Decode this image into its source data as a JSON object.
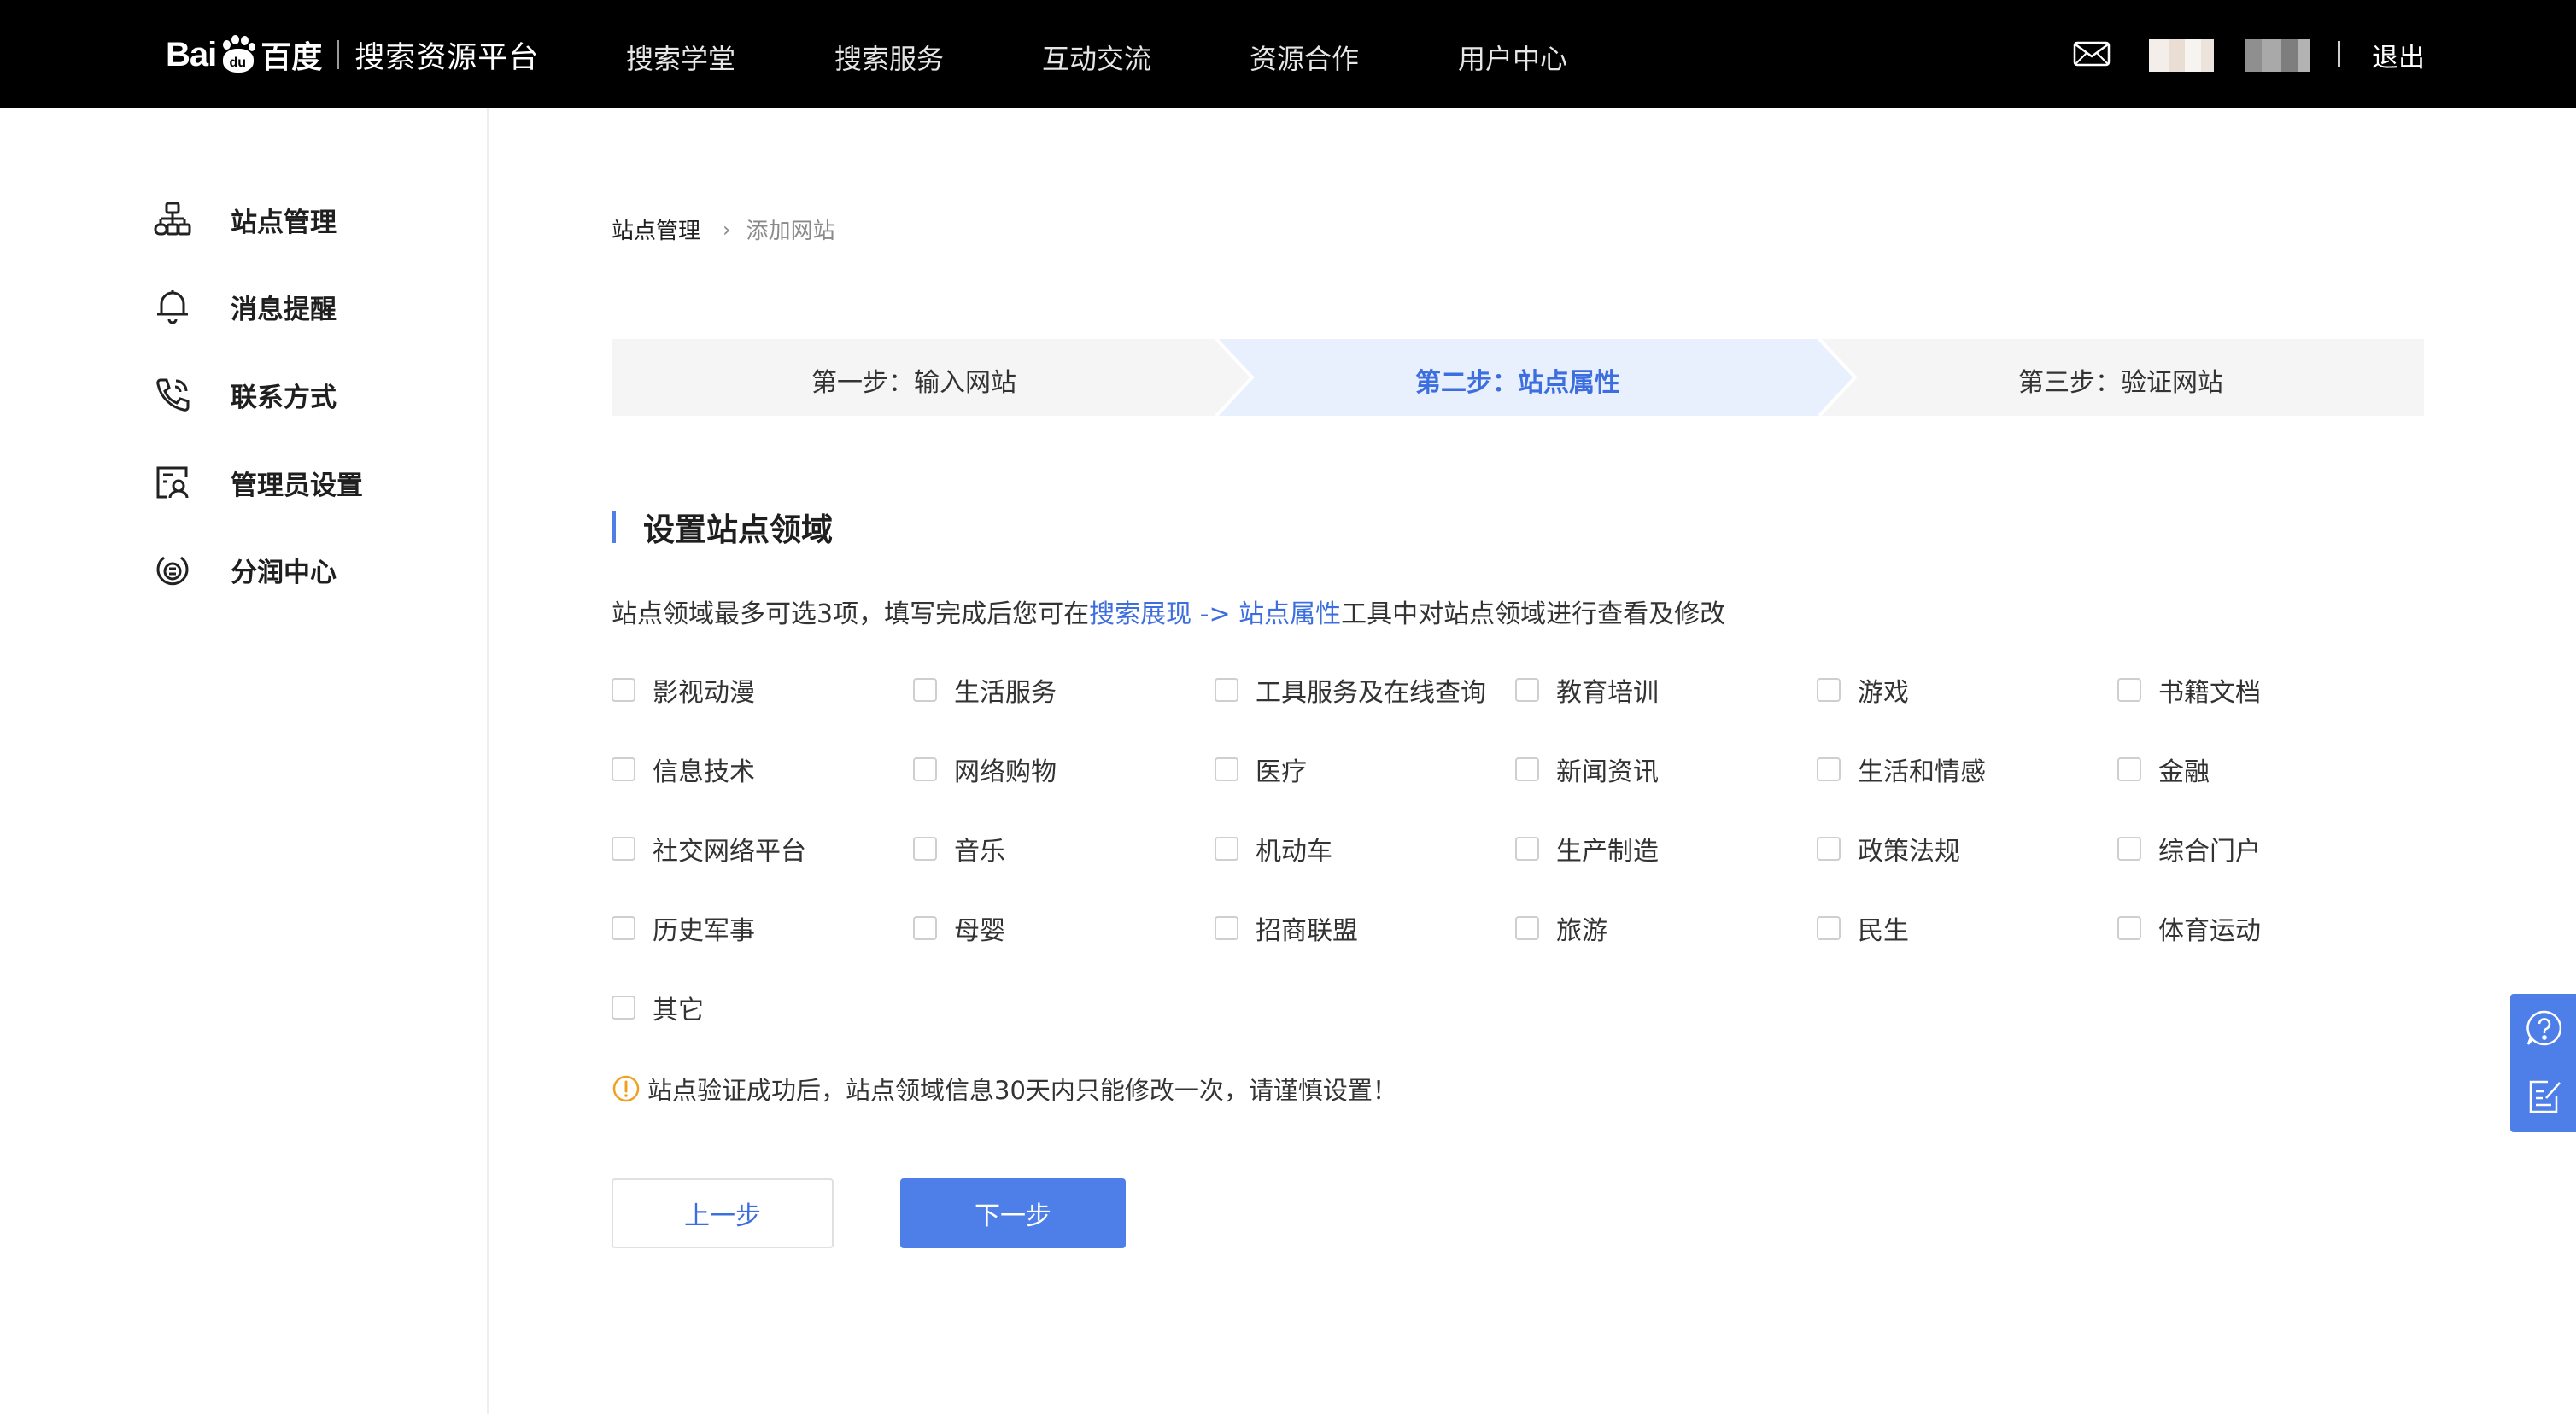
{
  "header": {
    "logo": {
      "bai": "Bai",
      "du": "du",
      "baidu_cn": "百度",
      "platform": "搜索资源平台"
    },
    "nav": [
      "搜索学堂",
      "搜索服务",
      "互动交流",
      "资源合作",
      "用户中心"
    ],
    "logout": "退出"
  },
  "sidebar": {
    "items": [
      {
        "label": "站点管理",
        "icon": "sitemap-icon"
      },
      {
        "label": "消息提醒",
        "icon": "bell-icon"
      },
      {
        "label": "联系方式",
        "icon": "phone-icon"
      },
      {
        "label": "管理员设置",
        "icon": "admin-icon"
      },
      {
        "label": "分润中心",
        "icon": "revenue-icon"
      }
    ]
  },
  "breadcrumb": {
    "root": "站点管理",
    "current": "添加网站"
  },
  "steps": [
    {
      "label": "第一步：输入网站",
      "active": false
    },
    {
      "label": "第二步：站点属性",
      "active": true
    },
    {
      "label": "第三步：验证网站",
      "active": false
    }
  ],
  "section": {
    "title": "设置站点领域",
    "desc_prefix": "站点领域最多可选3项，填写完成后您可在",
    "desc_link": "搜索展现 -> 站点属性",
    "desc_suffix": "工具中对站点领域进行查看及修改"
  },
  "domains": [
    "影视动漫",
    "生活服务",
    "工具服务及在线查询",
    "教育培训",
    "游戏",
    "书籍文档",
    "信息技术",
    "网络购物",
    "医疗",
    "新闻资讯",
    "生活和情感",
    "金融",
    "社交网络平台",
    "音乐",
    "机动车",
    "生产制造",
    "政策法规",
    "综合门户",
    "历史军事",
    "母婴",
    "招商联盟",
    "旅游",
    "民生",
    "体育运动",
    "其它"
  ],
  "warning": "站点验证成功后，站点领域信息30天内只能修改一次，请谨慎设置！",
  "buttons": {
    "prev": "上一步",
    "next": "下一步"
  },
  "colors": {
    "accent": "#4e7ee8",
    "link": "#3d6ee0",
    "step_active_bg": "#e9f0fd",
    "step_bg": "#f5f5f5",
    "warn": "#f0a020"
  }
}
